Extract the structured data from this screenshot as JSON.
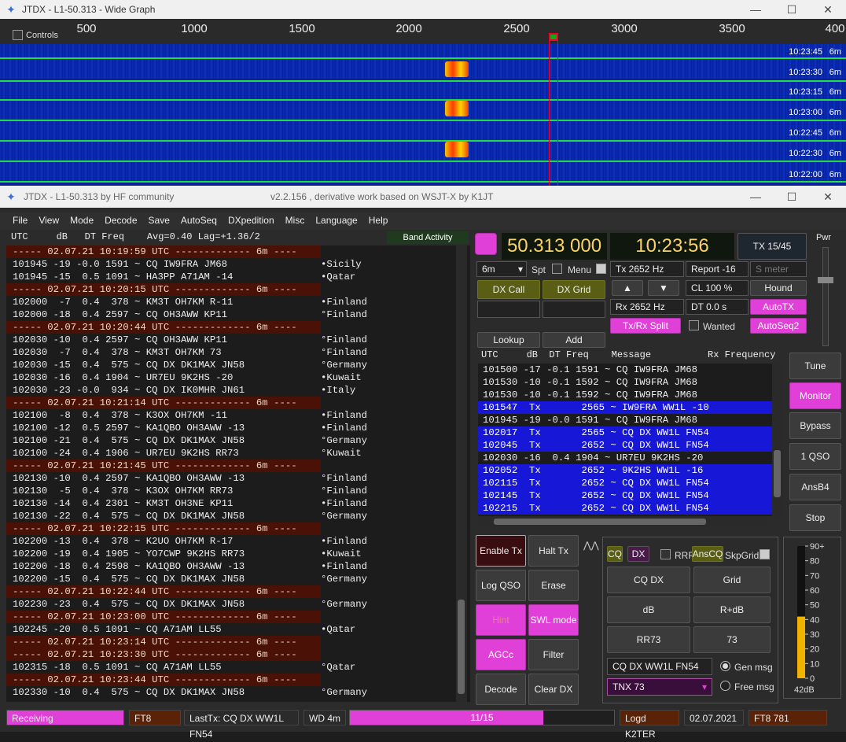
{
  "wide": {
    "title": "JTDX - L1-50.313 - Wide Graph",
    "controls": "Controls",
    "ticks": [
      "500",
      "1000",
      "1500",
      "2000",
      "2500",
      "3000",
      "3500",
      "400"
    ],
    "times": [
      "10:23:45",
      "10:23:30",
      "10:23:15",
      "10:23:00",
      "10:22:45",
      "10:22:30",
      "10:22:00"
    ],
    "band": "6m"
  },
  "main": {
    "title_left": "JTDX - L1-50.313  by HF community",
    "title_center": "v2.2.156 , derivative work based on WSJT-X by K1JT"
  },
  "menu": [
    "File",
    "View",
    "Mode",
    "Decode",
    "Save",
    "AutoSeq",
    "DXpedition",
    "Misc",
    "Language",
    "Help"
  ],
  "band_header": "UTC     dB   DT Freq    Avg=0.40 Lag=+1.36/2",
  "band_activity": "Band Activity",
  "left_rows": [
    {
      "t": "sep",
      "text": "----- 02.07.21 10:19:59 UTC ------------- 6m ----"
    },
    {
      "t": "row",
      "text": "101945 -19 -0.0 1591 ~ CQ IW9FRA JM68",
      "cty": "•Sicily"
    },
    {
      "t": "row",
      "text": "101945 -15  0.5 1091 ~ HA3PP A71AM -14",
      "cty": "•Qatar"
    },
    {
      "t": "sep",
      "text": "----- 02.07.21 10:20:15 UTC ------------- 6m ----"
    },
    {
      "t": "row",
      "text": "102000  -7  0.4  378 ~ KM3T OH7KM R-11",
      "cty": "•Finland"
    },
    {
      "t": "row",
      "text": "102000 -18  0.4 2597 ~ CQ OH3AWW KP11",
      "cty": "°Finland"
    },
    {
      "t": "sep",
      "text": "----- 02.07.21 10:20:44 UTC ------------- 6m ----"
    },
    {
      "t": "row",
      "text": "102030 -10  0.4 2597 ~ CQ OH3AWW KP11",
      "cty": "°Finland"
    },
    {
      "t": "row",
      "text": "102030  -7  0.4  378 ~ KM3T OH7KM 73",
      "cty": "°Finland"
    },
    {
      "t": "row",
      "text": "102030 -15  0.4  575 ~ CQ DX DK1MAX JN58",
      "cty": "°Germany"
    },
    {
      "t": "row",
      "text": "102030 -16  0.4 1904 ~ UR7EU 9K2HS -20",
      "cty": "•Kuwait"
    },
    {
      "t": "row",
      "text": "102030 -23 -0.0  934 ~ CQ DX IK0MHR JN61",
      "cty": "•Italy"
    },
    {
      "t": "sep",
      "text": "----- 02.07.21 10:21:14 UTC ------------- 6m ----"
    },
    {
      "t": "row",
      "text": "102100  -8  0.4  378 ~ K3OX OH7KM -11",
      "cty": "•Finland"
    },
    {
      "t": "row",
      "text": "102100 -12  0.5 2597 ~ KA1QBO OH3AWW -13",
      "cty": "•Finland"
    },
    {
      "t": "row",
      "text": "102100 -21  0.4  575 ~ CQ DX DK1MAX JN58",
      "cty": "°Germany"
    },
    {
      "t": "row",
      "text": "102100 -24  0.4 1906 ~ UR7EU 9K2HS RR73",
      "cty": "°Kuwait"
    },
    {
      "t": "sep",
      "text": "----- 02.07.21 10:21:45 UTC ------------- 6m ----"
    },
    {
      "t": "row",
      "text": "102130 -10  0.4 2597 ~ KA1QBO OH3AWW -13",
      "cty": "°Finland"
    },
    {
      "t": "row",
      "text": "102130  -5  0.4  378 ~ K3OX OH7KM RR73",
      "cty": "°Finland"
    },
    {
      "t": "row",
      "text": "102130 -14  0.4 2301 ~ KM3T OH3NE KP11",
      "cty": "•Finland"
    },
    {
      "t": "row",
      "text": "102130 -22  0.4  575 ~ CQ DX DK1MAX JN58",
      "cty": "°Germany"
    },
    {
      "t": "sep",
      "text": "----- 02.07.21 10:22:15 UTC ------------- 6m ----"
    },
    {
      "t": "row",
      "text": "102200 -13  0.4  378 ~ K2UO OH7KM R-17",
      "cty": "•Finland"
    },
    {
      "t": "row",
      "text": "102200 -19  0.4 1905 ~ YO7CWP 9K2HS RR73",
      "cty": "•Kuwait"
    },
    {
      "t": "row",
      "text": "102200 -18  0.4 2598 ~ KA1QBO OH3AWW -13",
      "cty": "•Finland"
    },
    {
      "t": "row",
      "text": "102200 -15  0.4  575 ~ CQ DX DK1MAX JN58",
      "cty": "°Germany"
    },
    {
      "t": "sep",
      "text": "----- 02.07.21 10:22:44 UTC ------------- 6m ----"
    },
    {
      "t": "row",
      "text": "102230 -23  0.4  575 ~ CQ DX DK1MAX JN58",
      "cty": "°Germany"
    },
    {
      "t": "sep",
      "text": "----- 02.07.21 10:23:00 UTC ------------- 6m ----"
    },
    {
      "t": "row",
      "text": "102245 -20  0.5 1091 ~ CQ A71AM LL55",
      "cty": "•Qatar"
    },
    {
      "t": "sep",
      "text": "----- 02.07.21 10:23:14 UTC ------------- 6m ----"
    },
    {
      "t": "sep",
      "text": "----- 02.07.21 10:23:30 UTC ------------- 6m ----"
    },
    {
      "t": "row",
      "text": "102315 -18  0.5 1091 ~ CQ A71AM LL55",
      "cty": "°Qatar"
    },
    {
      "t": "sep",
      "text": "----- 02.07.21 10:23:44 UTC ------------- 6m ----"
    },
    {
      "t": "row",
      "text": "102330 -10  0.4  575 ~ CQ DX DK1MAX JN58",
      "cty": "°Germany"
    }
  ],
  "freq": "50.313 000",
  "clock": "10:23:56",
  "tx_period": "TX 15/45",
  "pwr": "Pwr",
  "band_select": "6m",
  "spt": "Spt",
  "menu_cb": "Menu",
  "tx_hz": "Tx  2652  Hz",
  "rx_hz": "Rx  2652  Hz",
  "report": "Report -16",
  "smeter": "S meter",
  "cl": "CL  100 %",
  "hound": "Hound",
  "dt": "DT 0.0 s",
  "autotx": "AutoTX",
  "txrx_split": "Tx/Rx Split",
  "wanted": "Wanted",
  "autoseq2": "AutoSeq2",
  "dxcall": "DX Call",
  "dxgrid": "DX Grid",
  "lookup": "Lookup",
  "add": "Add",
  "right_header": "UTC     dB  DT Freq    Message          Rx Frequency",
  "right_rows": [
    {
      "tx": false,
      "text": "101500 -17 -0.1 1591 ~ CQ IW9FRA JM68"
    },
    {
      "tx": false,
      "text": "101530 -10 -0.1 1592 ~ CQ IW9FRA JM68"
    },
    {
      "tx": false,
      "text": "101530 -10 -0.1 1592 ~ CQ IW9FRA JM68"
    },
    {
      "tx": true,
      "text": "101547  Tx       2565 ~ IW9FRA WW1L -10"
    },
    {
      "tx": false,
      "text": "101945 -19 -0.0 1591 ~ CQ IW9FRA JM68"
    },
    {
      "tx": true,
      "text": "102017  Tx       2565 ~ CQ DX WW1L FN54"
    },
    {
      "tx": true,
      "text": "102045  Tx       2652 ~ CQ DX WW1L FN54"
    },
    {
      "tx": false,
      "text": "102030 -16  0.4 1904 ~ UR7EU 9K2HS -20"
    },
    {
      "tx": true,
      "text": "102052  Tx       2652 ~ 9K2HS WW1L -16"
    },
    {
      "tx": true,
      "text": "102115  Tx       2652 ~ CQ DX WW1L FN54"
    },
    {
      "tx": true,
      "text": "102145  Tx       2652 ~ CQ DX WW1L FN54"
    },
    {
      "tx": true,
      "text": "102215  Tx       2652 ~ CQ DX WW1L FN54"
    }
  ],
  "side_buttons": [
    "Tune",
    "Monitor",
    "Bypass",
    "1 QSO",
    "AnsB4",
    "Stop"
  ],
  "ctl": {
    "enable_tx": "Enable Tx",
    "halt_tx": "Halt Tx",
    "log_qso": "Log QSO",
    "erase": "Erase",
    "hint": "Hint",
    "swl_mode": "SWL mode",
    "agcc": "AGCc",
    "filter": "Filter",
    "decode": "Decode",
    "clear_dx": "Clear DX"
  },
  "txp": {
    "cq": "CQ",
    "dx": "DX",
    "rrr": "RRR",
    "anscq": "AnsCQ",
    "skpgrid": "SkpGrid",
    "cqdx": "CQ DX",
    "grid": "Grid",
    "db": "dB",
    "rdb": "R+dB",
    "rr73": "RR73",
    "s73": "73",
    "gen_value": "CQ DX WW1L FN54",
    "gen_msg": "Gen msg",
    "free_value": "TNX 73",
    "free_msg": "Free msg"
  },
  "meter": {
    "labels": [
      "90+",
      "80",
      "70",
      "60",
      "50",
      "40",
      "30",
      "20",
      "10",
      "0"
    ],
    "level_db": "42dB",
    "level": 42
  },
  "status": {
    "receiving": "Receiving",
    "mode": "FT8",
    "lasttx": "LastTx: CQ DX WW1L FN54",
    "wd": "WD 4m",
    "progress": "11/15",
    "progress_frac": 0.733,
    "logd": "Logd K2TER",
    "date": "02.07.2021",
    "mode2": "FT8  781"
  }
}
